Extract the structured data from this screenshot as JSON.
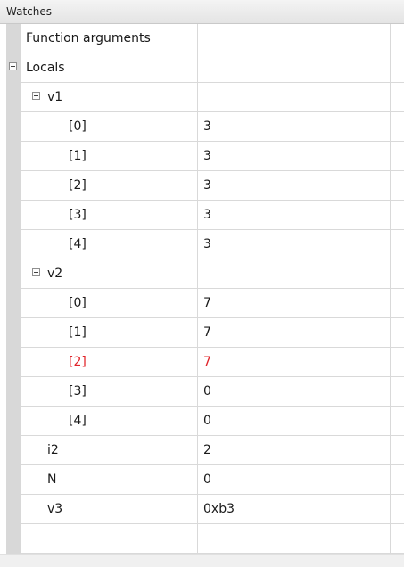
{
  "window": {
    "title": "Watches"
  },
  "rows": [
    {
      "name": "Function arguments",
      "value": "",
      "level": 0,
      "expander": false
    },
    {
      "name": "Locals",
      "value": "",
      "level": 0,
      "expander": true
    },
    {
      "name": "v1",
      "value": "",
      "level": 1,
      "expander": true
    },
    {
      "name": "[0]",
      "value": "3",
      "level": 2,
      "expander": false
    },
    {
      "name": "[1]",
      "value": "3",
      "level": 2,
      "expander": false
    },
    {
      "name": "[2]",
      "value": "3",
      "level": 2,
      "expander": false
    },
    {
      "name": "[3]",
      "value": "3",
      "level": 2,
      "expander": false
    },
    {
      "name": "[4]",
      "value": "3",
      "level": 2,
      "expander": false
    },
    {
      "name": "v2",
      "value": "",
      "level": 1,
      "expander": true
    },
    {
      "name": "[0]",
      "value": "7",
      "level": 2,
      "expander": false
    },
    {
      "name": "[1]",
      "value": "7",
      "level": 2,
      "expander": false
    },
    {
      "name": "[2]",
      "value": "7",
      "level": 2,
      "expander": false,
      "changed": true
    },
    {
      "name": "[3]",
      "value": "0",
      "level": 2,
      "expander": false
    },
    {
      "name": "[4]",
      "value": "0",
      "level": 2,
      "expander": false
    },
    {
      "name": "i2",
      "value": "2",
      "level": 1,
      "expander": false
    },
    {
      "name": "N",
      "value": "0",
      "level": 1,
      "expander": false
    },
    {
      "name": "v3",
      "value": "0xb3",
      "level": 1,
      "expander": false
    },
    {
      "name": "",
      "value": "",
      "level": 0,
      "expander": false
    }
  ],
  "colors": {
    "changed_value": "#e0242a",
    "indicator_column": "#d8d8d8"
  }
}
